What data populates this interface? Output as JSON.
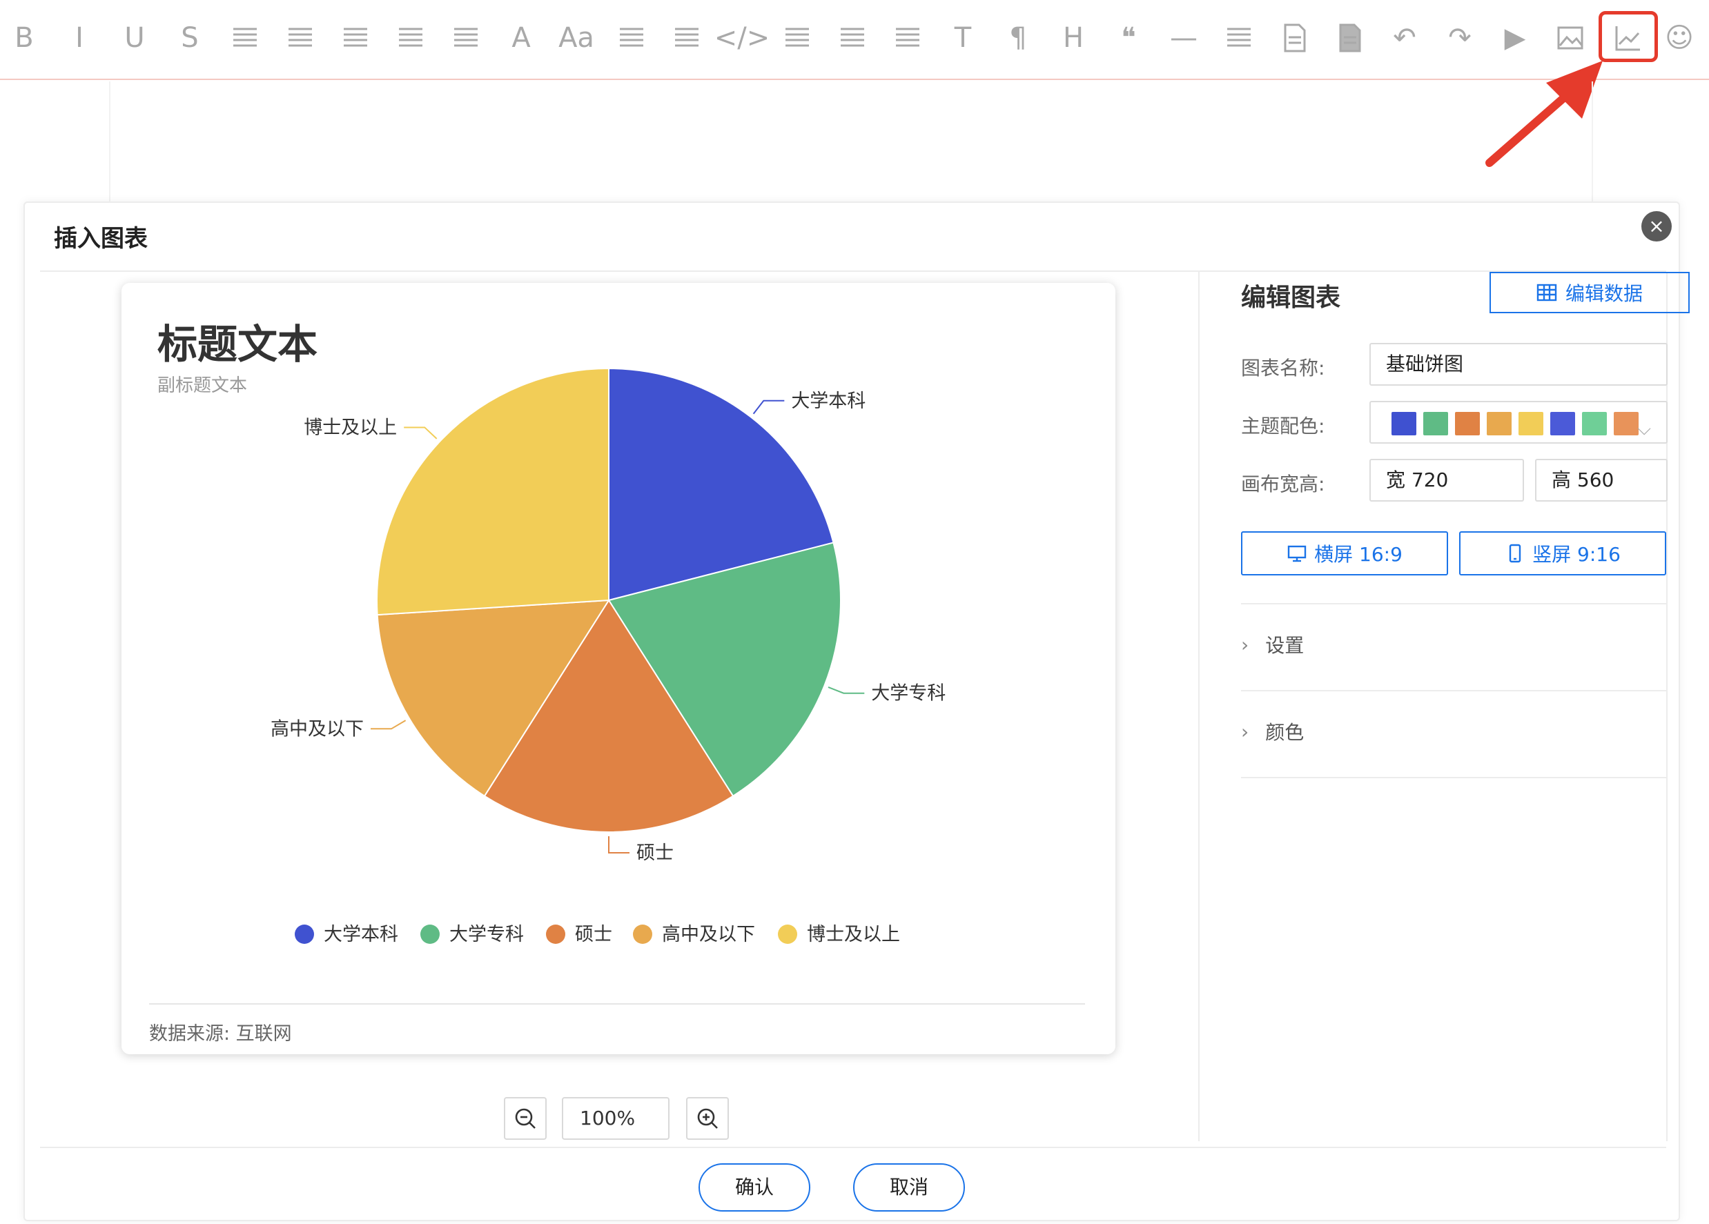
{
  "toolbar": {
    "items": [
      {
        "icon": "bold-icon",
        "glyph": "B"
      },
      {
        "icon": "italic-icon",
        "glyph": "I"
      },
      {
        "icon": "underline-icon",
        "glyph": "U"
      },
      {
        "icon": "strikethrough-icon",
        "glyph": "S"
      },
      {
        "icon": "line-height-icon",
        "glyph": ""
      },
      {
        "icon": "align-left-icon",
        "glyph": ""
      },
      {
        "icon": "align-center-icon",
        "glyph": ""
      },
      {
        "icon": "align-right-icon",
        "glyph": ""
      },
      {
        "icon": "align-justify-icon",
        "glyph": ""
      },
      {
        "icon": "font-color-icon",
        "glyph": "A"
      },
      {
        "icon": "font-size-icon",
        "glyph": "Aa"
      },
      {
        "icon": "indent-icon",
        "glyph": ""
      },
      {
        "icon": "outdent-icon",
        "glyph": ""
      },
      {
        "icon": "code-icon",
        "glyph": "</>"
      },
      {
        "icon": "bullet-list-icon",
        "glyph": ""
      },
      {
        "icon": "numbered-list-icon",
        "glyph": ""
      },
      {
        "icon": "code-block-icon",
        "glyph": ""
      },
      {
        "icon": "clear-format-icon",
        "glyph": "T"
      },
      {
        "icon": "paragraph-icon",
        "glyph": "¶"
      },
      {
        "icon": "heading-icon",
        "glyph": "H"
      },
      {
        "icon": "quote-icon",
        "glyph": "❝"
      },
      {
        "icon": "horizontal-rule-icon",
        "glyph": "—"
      },
      {
        "icon": "wrap-icon",
        "glyph": ""
      },
      {
        "icon": "document-icon",
        "glyph": ""
      },
      {
        "icon": "document-filled-icon",
        "glyph": ""
      },
      {
        "icon": "undo-icon",
        "glyph": "↶"
      },
      {
        "icon": "redo-icon",
        "glyph": "↷"
      },
      {
        "icon": "video-icon",
        "glyph": "▶"
      },
      {
        "icon": "image-icon",
        "glyph": ""
      },
      {
        "icon": "chart-icon",
        "glyph": ""
      },
      {
        "icon": "emoji-icon",
        "glyph": "☺"
      }
    ]
  },
  "dialog": {
    "title": "插入图表",
    "close_glyph": "×",
    "confirm": "确认",
    "cancel": "取消",
    "zoom": "100%"
  },
  "card": {
    "title": "标题文本",
    "subtitle": "副标题文本",
    "source": "数据来源: 互联网"
  },
  "panel": {
    "title": "编辑图表",
    "edit_data": "编辑数据",
    "name_label": "图表名称:",
    "name_value": "基础饼图",
    "theme_label": "主题配色:",
    "theme_colors": [
      "#3f51d0",
      "#5fbb85",
      "#e08244",
      "#e8a94e",
      "#f2cd57",
      "#4b5ad8",
      "#6fcf97",
      "#e8935a"
    ],
    "size_label": "画布宽高:",
    "width_value": "宽 720",
    "height_value": "高 560",
    "landscape": "横屏 16:9",
    "portrait": "竖屏 9:16",
    "settings": "设置",
    "colors": "颜色"
  },
  "chart_data": {
    "type": "pie",
    "title": "标题文本",
    "subtitle": "副标题文本",
    "categories": [
      "大学本科",
      "大学专科",
      "硕士",
      "高中及以下",
      "博士及以上"
    ],
    "values": [
      21,
      20,
      18,
      15,
      26
    ],
    "colors": [
      "#4052d0",
      "#5fbb85",
      "#e08244",
      "#e8a94e",
      "#f2cd57"
    ],
    "legend": "bottom",
    "source": "数据来源: 互联网"
  }
}
